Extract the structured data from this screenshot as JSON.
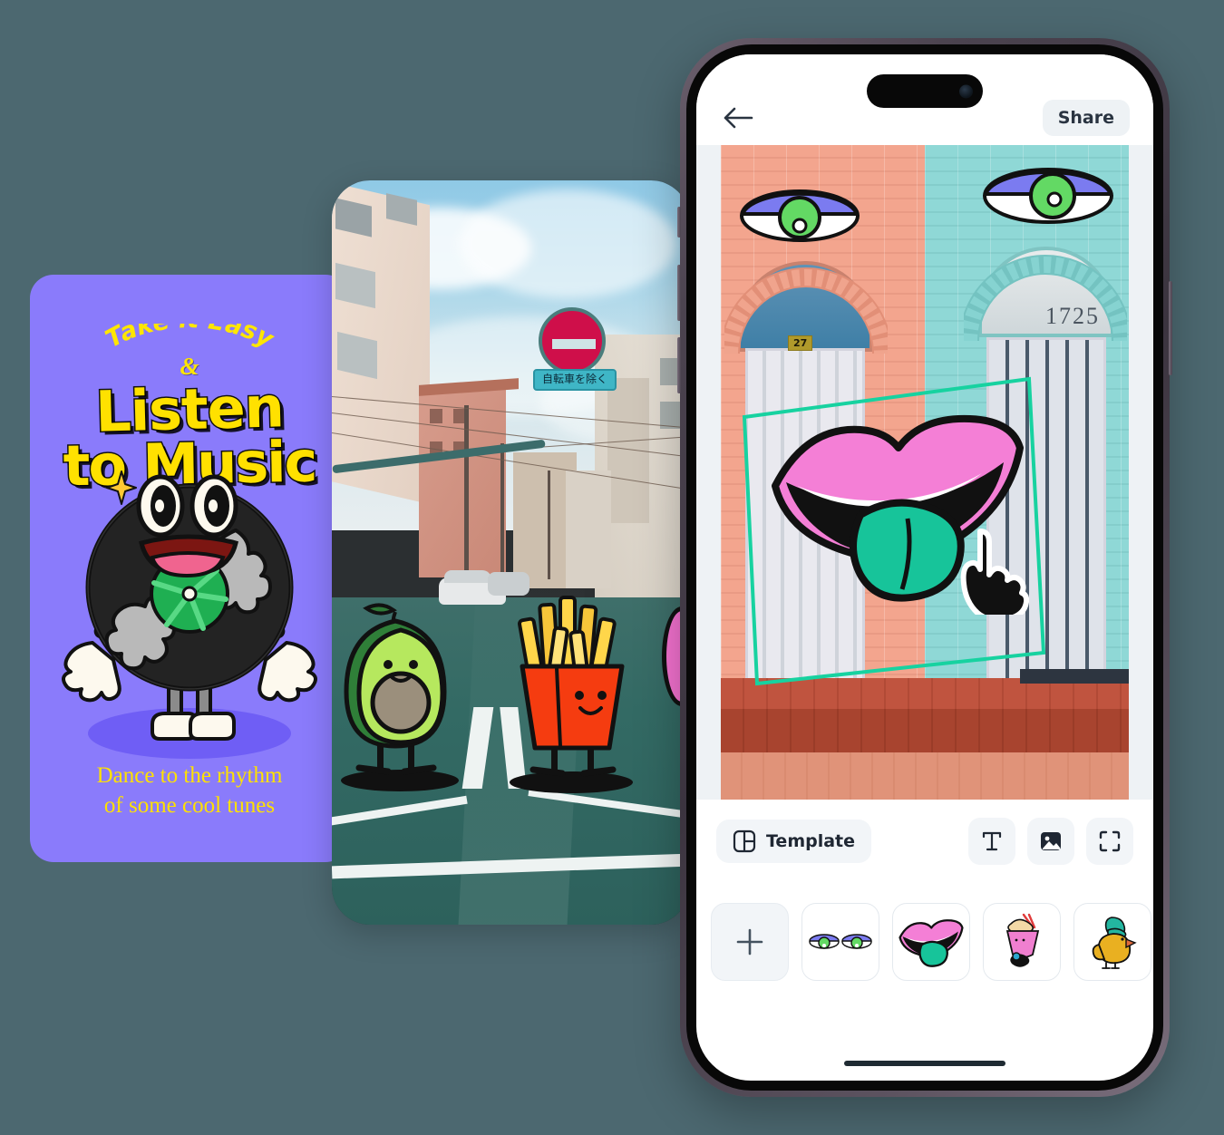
{
  "background_color": "#4c6870",
  "story_card": {
    "background_color": "#8a7bfb",
    "accent_color": "#ffe100",
    "arc_text": "Take it Easy",
    "ampersand": "&",
    "headline_line1": "Listen",
    "headline_line2": "to Music",
    "caption_line1": "Dance to the rhythm",
    "caption_line2": "of some cool tunes",
    "character": "vinyl-record-character"
  },
  "street_phone": {
    "scene": "japanese-street-photo",
    "road_sign_text": "自転車を除く",
    "road_sign_type": "no-entry",
    "characters": [
      "avocado-character",
      "french-fries-character"
    ]
  },
  "editor_phone": {
    "topbar": {
      "back_label": "Back",
      "share_label": "Share"
    },
    "canvas": {
      "photo": "colorful-doorways-photo",
      "house_number_right": "1725",
      "house_number_left": "27",
      "selected_sticker": "lips-sticker",
      "selection_color": "#17d2a0",
      "cursor": "pointing-hand-cursor",
      "stickers_on_canvas": [
        "eye-sticker-left",
        "eye-sticker-right",
        "lips-sticker"
      ]
    },
    "toolbar": {
      "template_label": "Template",
      "template_icon": "layout-icon",
      "text_icon": "text-T-icon",
      "image_icon": "image-icon",
      "crop_icon": "expand-frame-icon"
    },
    "tray": {
      "add_label": "+",
      "items": [
        {
          "name": "add-sticker",
          "icon": "plus-icon"
        },
        {
          "name": "eyes-sticker",
          "icon": "eyes-icon"
        },
        {
          "name": "lips-sticker",
          "icon": "lips-icon"
        },
        {
          "name": "milkshake-sticker",
          "icon": "milkshake-icon"
        },
        {
          "name": "duck-sticker",
          "icon": "duck-icon"
        }
      ]
    },
    "home_indicator": true
  }
}
